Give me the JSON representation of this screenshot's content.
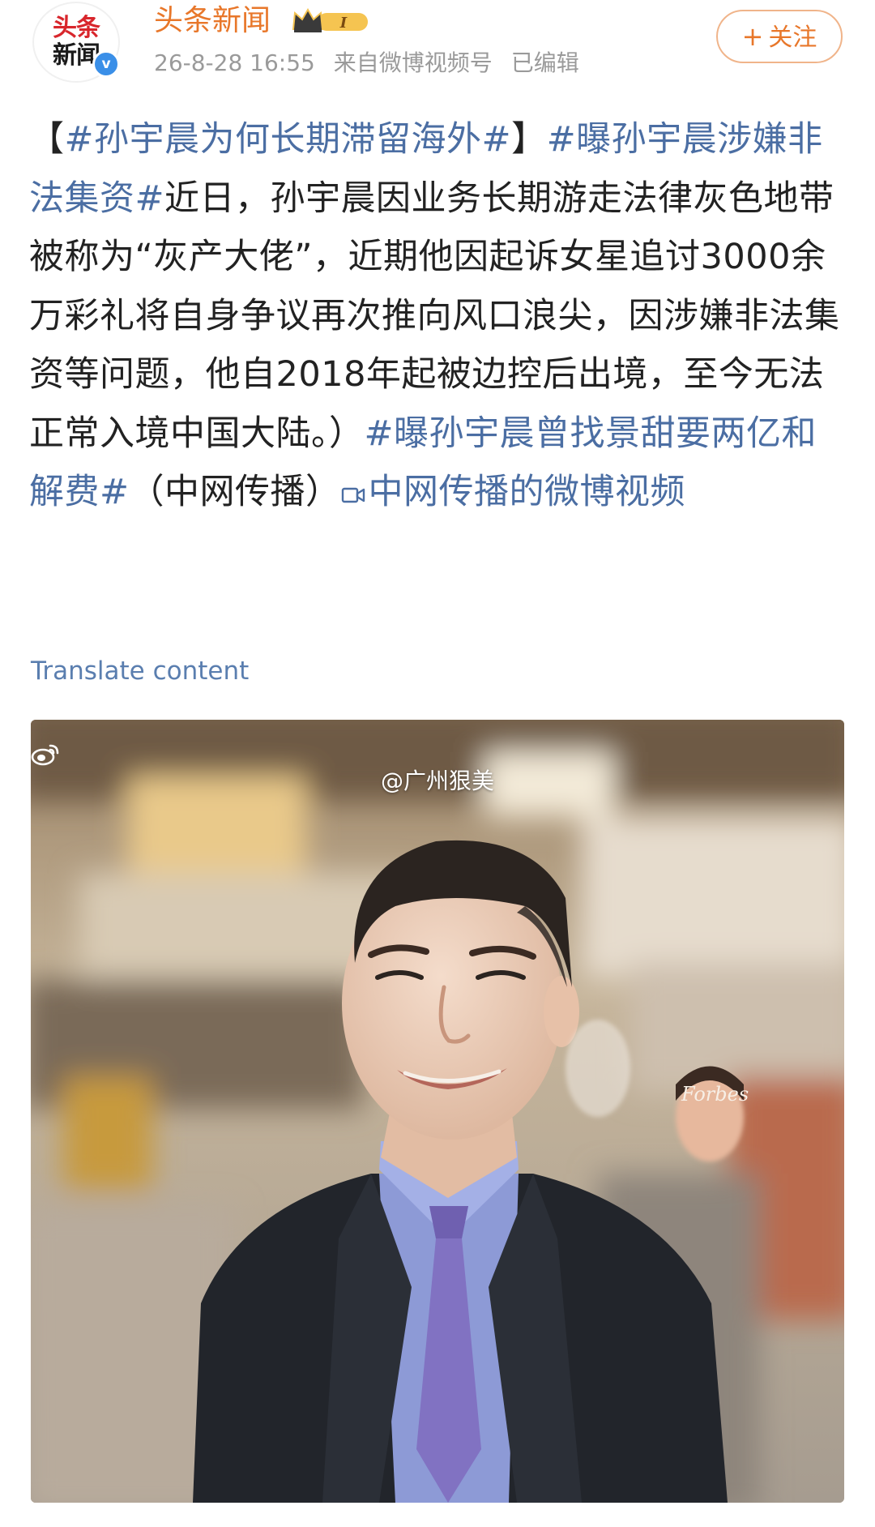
{
  "header": {
    "avatar": {
      "line1": "头条",
      "line2": "新闻",
      "verified_mark": "v"
    },
    "username": "头条新闻",
    "member_badge_text": "I",
    "meta": {
      "timestamp": "26-8-28 16:55",
      "source": "来自微博视频号",
      "edited": "已编辑"
    },
    "follow_button": {
      "plus": "+",
      "label": "关注"
    }
  },
  "post": {
    "segments": [
      {
        "text": "【",
        "type": "text"
      },
      {
        "text": "#孙宇晨为何长期滞留海外#",
        "type": "tag"
      },
      {
        "text": "】",
        "type": "text"
      },
      {
        "text": "#曝孙宇晨涉嫌非法集资#",
        "type": "tag"
      },
      {
        "text": "近日，孙宇晨因业务长期游走法律灰色地带被称为“灰产大佬”，近期他因起诉女星追讨3000余万彩礼将自身争议再次推向风口浪尖，因涉嫌非法集资等问题，他自2018年起被边控后出境，至今无法正常入境中国大陆。）",
        "type": "text"
      },
      {
        "text": "#曝孙宇晨曾找景甜要两亿和解费#",
        "type": "tag"
      },
      {
        "text": "（中网传播）",
        "type": "text"
      },
      {
        "text": "中网传播的微博视频",
        "type": "video-link"
      }
    ]
  },
  "translate_label": "Translate content",
  "video": {
    "watermark": "@广州狠美",
    "watermark_icon": "weibo-logo-icon",
    "magazine_text": "Forbes"
  },
  "colors": {
    "accent_orange": "#e8772a",
    "link_blue": "#4b6ea3",
    "meta_gray": "#9a9a9a",
    "text": "#222222"
  }
}
